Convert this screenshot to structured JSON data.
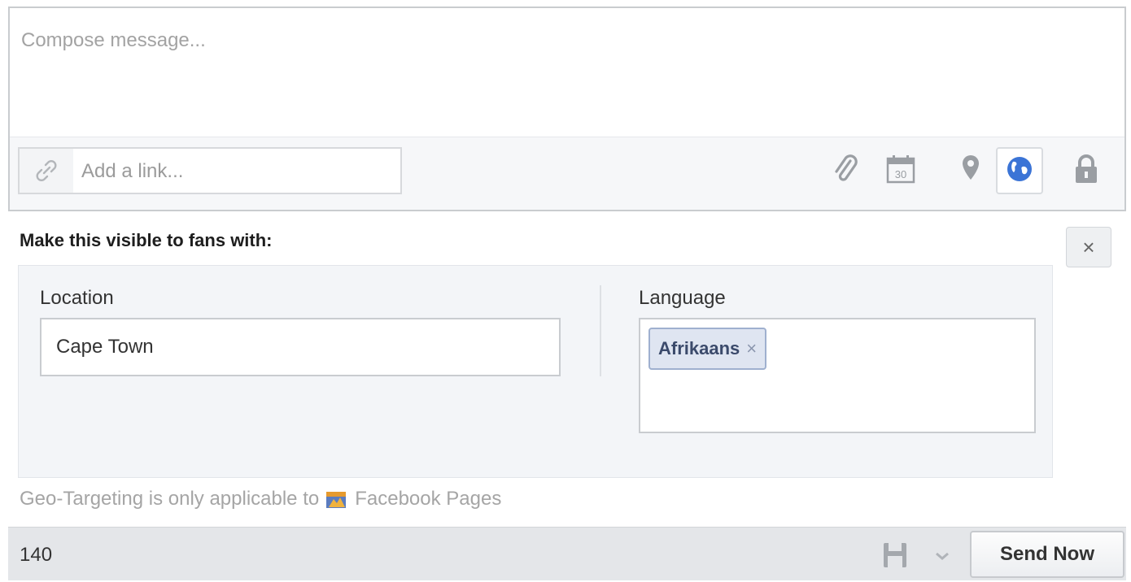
{
  "composer": {
    "message_placeholder": "Compose message...",
    "link_placeholder": "Add a link...",
    "tools": [
      "paperclip-icon",
      "calendar-icon",
      "map-pin-icon",
      "globe-icon",
      "lock-icon"
    ],
    "calendar_day": "30",
    "active_tool": "globe-icon"
  },
  "visibility": {
    "header": "Make this visible to fans with:",
    "close_label": "×",
    "location": {
      "label": "Location",
      "value": "Cape Town"
    },
    "language": {
      "label": "Language",
      "tokens": [
        {
          "label": "Afrikaans",
          "remove_label": "×"
        }
      ]
    },
    "note_prefix": "Geo-Targeting is only applicable to",
    "note_link": "Facebook Pages"
  },
  "footer": {
    "char_count": "140",
    "send_label": "Send Now"
  },
  "colors": {
    "globe": "#3b74d6",
    "icon_gray": "#9a9ea3",
    "token_bg": "#dfe5f1"
  }
}
